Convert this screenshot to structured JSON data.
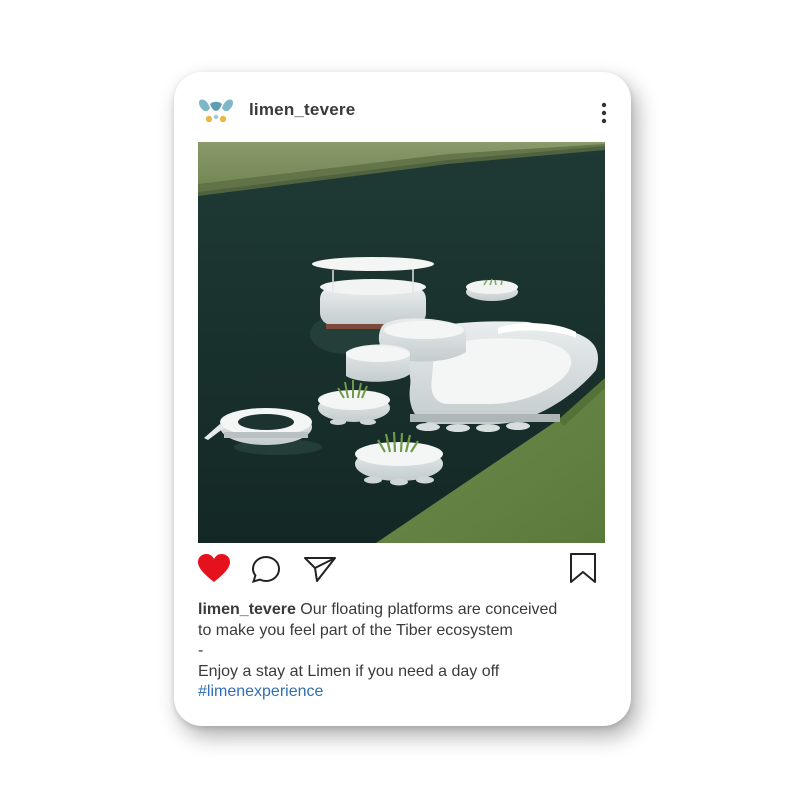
{
  "post": {
    "username": "limen_tevere",
    "caption": {
      "username": "limen_tevere",
      "line1": "Our floating platforms are conceived",
      "line2": "to make you feel part of the Tiber ecosystem",
      "separator": "-",
      "line3": "Enjoy a stay at Limen if you need a day off",
      "hashtag": "#limenexperience"
    },
    "liked": true
  },
  "icons": {
    "avatar": "limen-logo-icon",
    "more": "vertical-dots-icon",
    "like": "heart-icon",
    "comment": "comment-bubble-icon",
    "share": "paper-plane-icon",
    "save": "bookmark-icon"
  },
  "colors": {
    "like": "#e5121e",
    "hashtag": "#2f6fb1",
    "text": "#3a3a3a",
    "logo_blue": "#7fb7c9",
    "logo_yellow": "#e8b84a"
  }
}
